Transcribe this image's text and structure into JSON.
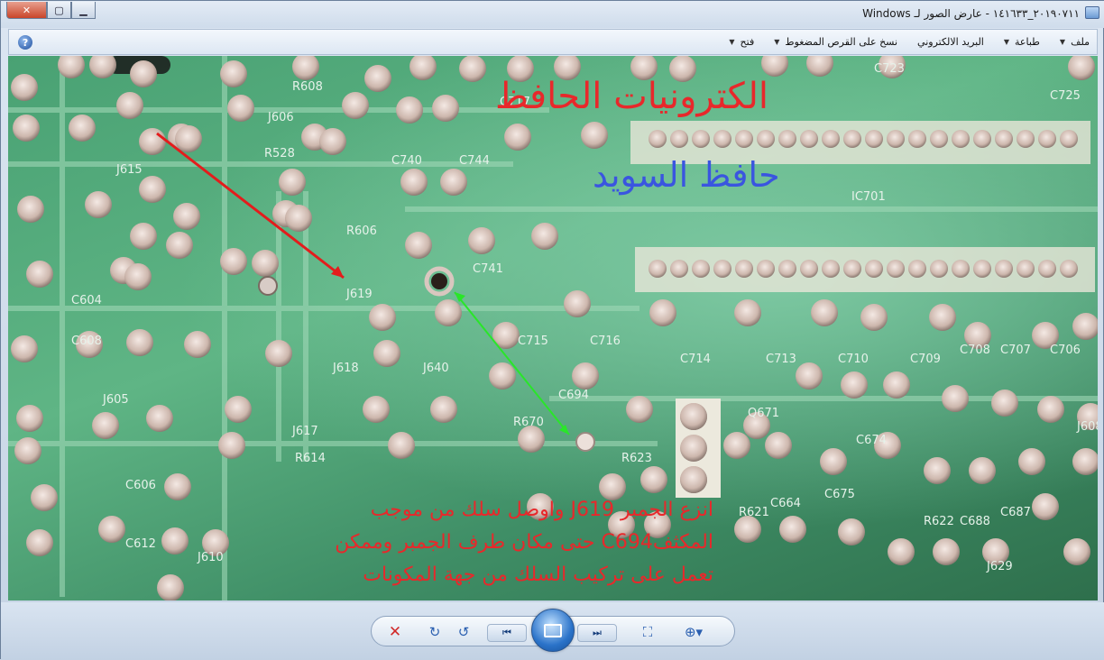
{
  "window": {
    "title": "٢٠١٩٠٧١١_١٤١٦٣٣ - عارض الصور لـ Windows"
  },
  "menu": {
    "file": "ملف",
    "print": "طباعة",
    "email": "البريد الالكتروني",
    "burn": "نسخ على القرص المضغوط",
    "open": "فتح"
  },
  "photo": {
    "heading": "الكترونيات الحافظ",
    "subheading": "حافظ السويد",
    "note_line1": "انزع الجمبر J619 واوصل سلك من موجب",
    "note_line2": "المكثفC694 حتى مكان طرف الجمبر وممكن",
    "note_line3": "تعمل على تركيب السلك من جهة المكونات",
    "board_labels": [
      "R608",
      "J606",
      "R528",
      "C740",
      "C744",
      "C717",
      "R606",
      "C741",
      "J619",
      "C715",
      "C716",
      "C714",
      "C713",
      "C710",
      "C709",
      "C708",
      "C707",
      "C706",
      "J640",
      "R670",
      "C694",
      "R623",
      "Q671",
      "C674",
      "R621",
      "C664",
      "C675",
      "R622",
      "C688",
      "C687",
      "J608",
      "J617",
      "R614",
      "J605",
      "C606",
      "C612",
      "J610",
      "C604",
      "C608",
      "IC701",
      "C723",
      "C725",
      "J629",
      "J618",
      "J615"
    ]
  },
  "toolbar": {
    "delete_icon": "delete-icon",
    "rotate_cw_icon": "rotate-clockwise-icon",
    "rotate_ccw_icon": "rotate-counterclockwise-icon",
    "prev_icon": "previous-icon",
    "slideshow_icon": "slideshow-icon",
    "next_icon": "next-icon",
    "actual_size_icon": "actual-size-icon",
    "zoom_icon": "zoom-icon"
  }
}
